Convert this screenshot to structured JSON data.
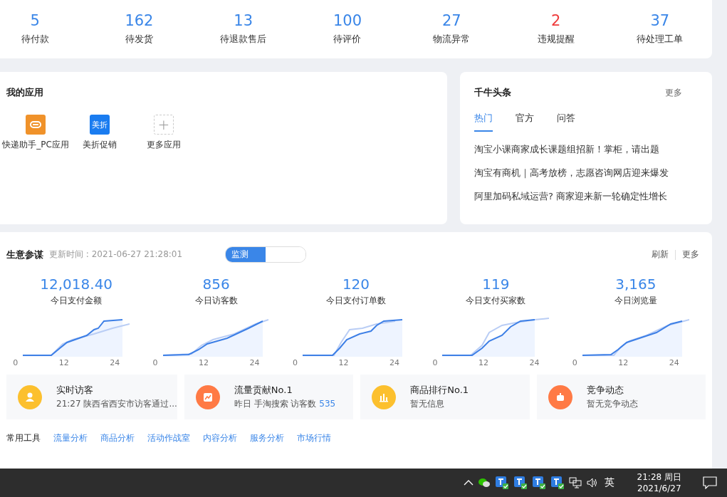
{
  "order_stats": [
    {
      "value": "5",
      "label": "待付款",
      "alert": false
    },
    {
      "value": "162",
      "label": "待发货",
      "alert": false
    },
    {
      "value": "13",
      "label": "待退款售后",
      "alert": false
    },
    {
      "value": "100",
      "label": "待评价",
      "alert": false
    },
    {
      "value": "27",
      "label": "物流异常",
      "alert": false
    },
    {
      "value": "2",
      "label": "违规提醒",
      "alert": true
    },
    {
      "value": "37",
      "label": "待处理工单",
      "alert": false
    }
  ],
  "my_apps": {
    "title": "我的应用",
    "apps": [
      {
        "kind": "courier",
        "label": "快递助手_PC应用"
      },
      {
        "kind": "badge",
        "icon_text": "美折",
        "label": "美折促销"
      },
      {
        "kind": "add",
        "icon_text": "+",
        "label": "更多应用"
      }
    ]
  },
  "headlines": {
    "title": "千牛头条",
    "more": "更多",
    "tabs": [
      {
        "label": "热门",
        "selected": true
      },
      {
        "label": "官方",
        "selected": false
      },
      {
        "label": "问答",
        "selected": false
      }
    ],
    "items": [
      "淘宝小课商家成长课题组招新！掌柜，请出题",
      "淘宝有商机｜高考放榜，志愿咨询网店迎来爆发",
      "阿里加码私域运营? 商家迎来新一轮确定性增长"
    ]
  },
  "business": {
    "title": "生意参谋",
    "updated": "更新时间 : 2021-06-27 21:28:01",
    "mode_tabs": [
      {
        "label": "监测",
        "selected": true
      },
      {
        "selected": false
      }
    ],
    "refresh": "刷新",
    "more": "更多",
    "metrics": [
      {
        "value": "12,018.40",
        "label": "今日支付金额",
        "x_labels": [
          "0",
          "12",
          "24"
        ]
      },
      {
        "value": "856",
        "label": "今日访客数",
        "x_labels": [
          "0",
          "12",
          "24"
        ]
      },
      {
        "value": "120",
        "label": "今日支付订单数",
        "x_labels": [
          "0",
          "12",
          "24"
        ]
      },
      {
        "value": "119",
        "label": "今日支付买家数",
        "x_labels": [
          "0",
          "12",
          "24"
        ]
      },
      {
        "value": "3,165",
        "label": "今日浏览量",
        "x_labels": [
          "0",
          "12",
          "24"
        ]
      }
    ],
    "insights": [
      {
        "kind": "visitor",
        "color": "#fcc02e",
        "title": "实时访客",
        "text": "21:27 陕西省西安市访客通过..."
      },
      {
        "kind": "traffic",
        "color": "#ff7a45",
        "title": "流量贡献No.1",
        "text": "昨日 手淘搜索 访客数",
        "count": "535"
      },
      {
        "kind": "ranking",
        "color": "#fcc02e",
        "title": "商品排行No.1",
        "text": "暂无信息"
      },
      {
        "kind": "competition",
        "color": "#ff7a45",
        "title": "竞争动态",
        "text": "暂无竞争动态"
      }
    ],
    "tools_label": "常用工具",
    "tools": [
      "流量分析",
      "商品分析",
      "活动作战室",
      "内容分析",
      "服务分析",
      "市场行情"
    ]
  },
  "taskbar": {
    "ime": "英",
    "time": "21:28 周日",
    "date": "2021/6/27"
  }
}
